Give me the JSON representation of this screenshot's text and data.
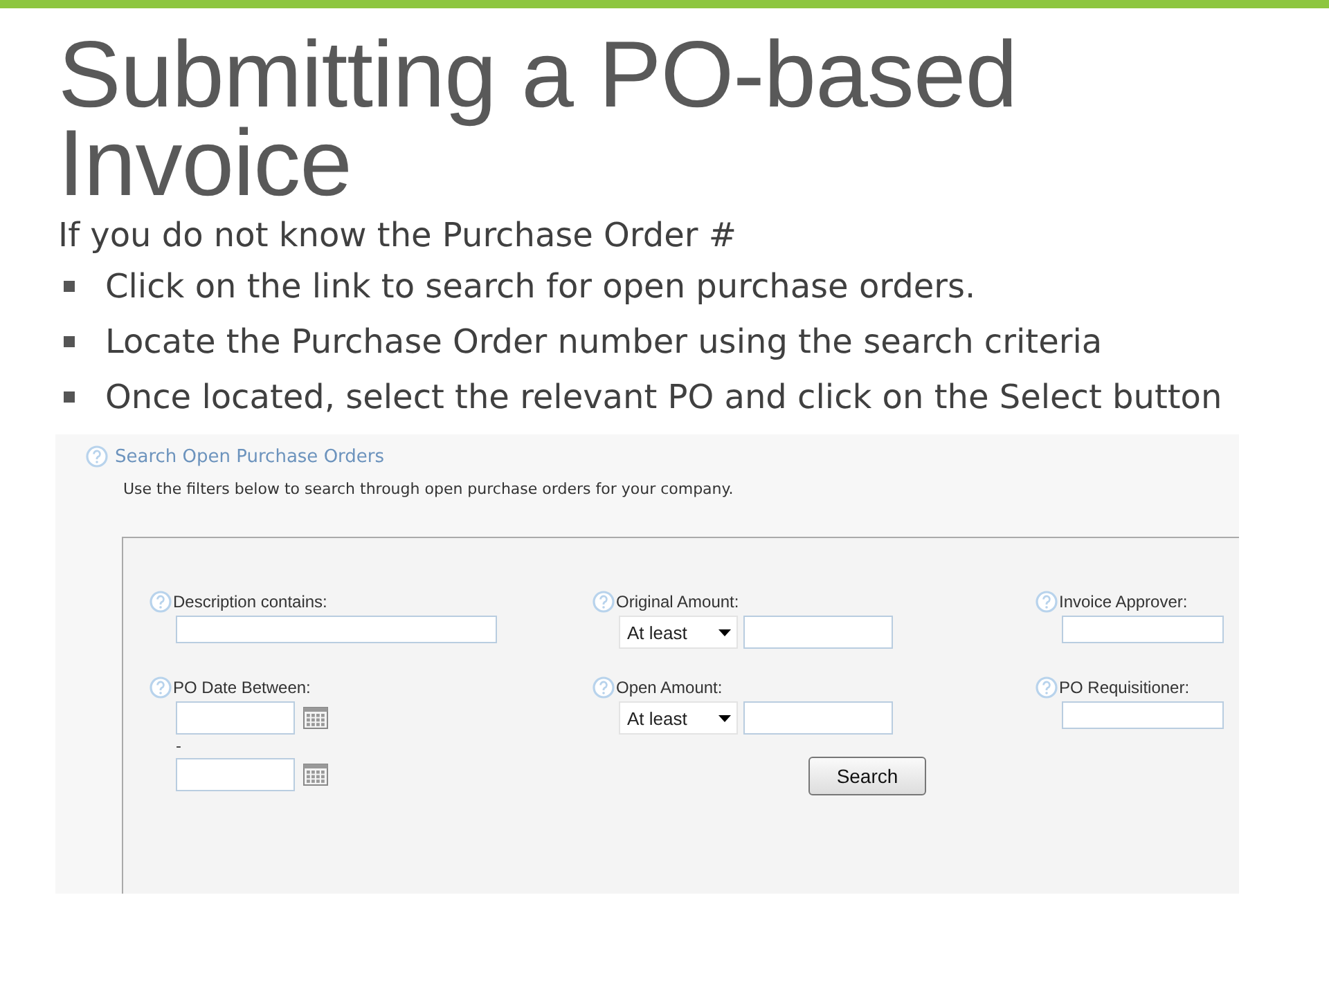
{
  "slide": {
    "title": "Submitting a PO-based Invoice",
    "subtitle": "If you do not know the Purchase Order #",
    "bullets": [
      "Click on the link to search for open purchase orders.",
      "Locate the Purchase Order number using the search criteria",
      "Once located, select the relevant PO and click on the Select button"
    ]
  },
  "form": {
    "heading": "Search Open Purchase Orders",
    "intro": "Use the filters below to search through open purchase orders for your company.",
    "fields": [
      {
        "kind": "text",
        "label": "Description contains:"
      },
      {
        "kind": "amount",
        "label": "Original Amount:",
        "operator": "At least"
      },
      {
        "kind": "text",
        "label": "Invoice Approver:"
      },
      {
        "kind": "date_range",
        "label": "PO Date Between:",
        "separator": "-"
      },
      {
        "kind": "amount",
        "label": "Open Amount:",
        "operator": "At least"
      },
      {
        "kind": "text",
        "label": "PO Requisitioner:"
      }
    ],
    "search_button": "Search"
  }
}
